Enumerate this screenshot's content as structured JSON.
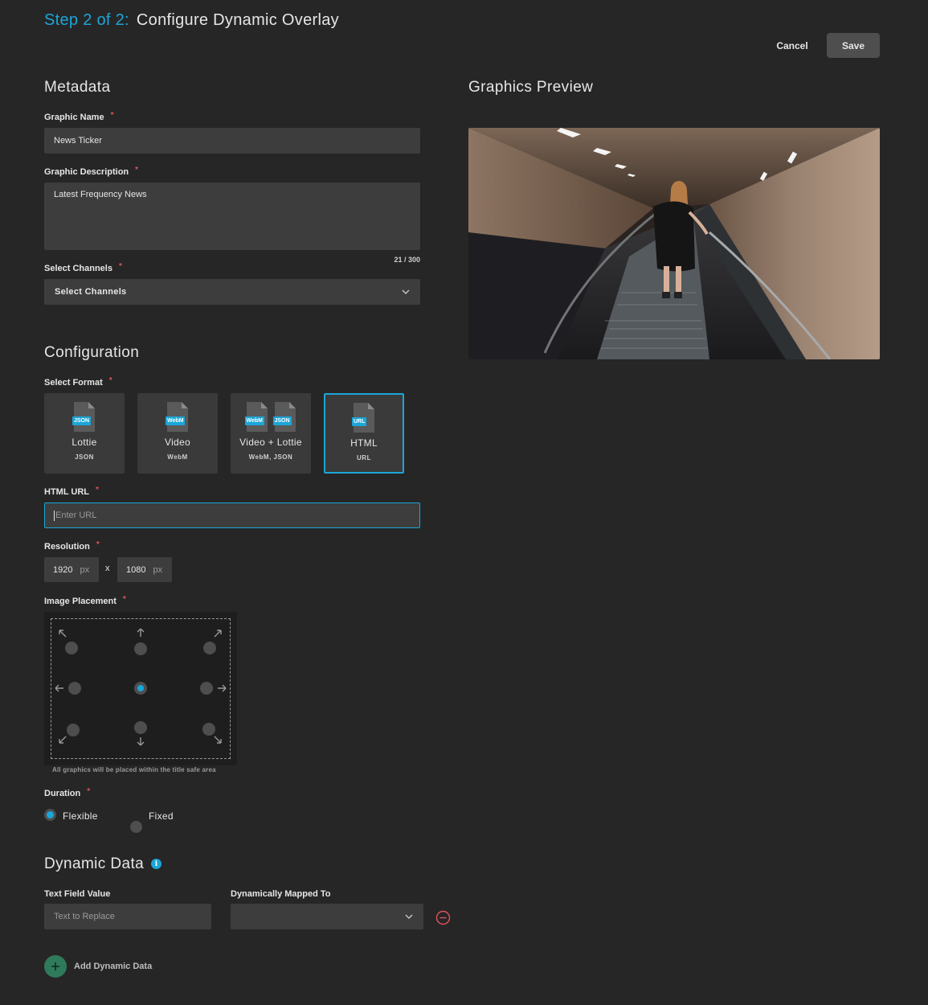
{
  "header": {
    "step": "Step 2 of 2:",
    "title": "Configure Dynamic Overlay",
    "cancel_label": "Cancel",
    "save_label": "Save"
  },
  "metadata": {
    "heading": "Metadata",
    "name_label": "Graphic Name",
    "name_value": "News Ticker",
    "description_label": "Graphic Description",
    "description_value": "Latest Frequency News",
    "char_counter": "21 / 300",
    "channels_label": "Select Channels",
    "channels_value": "Select Channels"
  },
  "preview": {
    "heading": "Graphics Preview"
  },
  "configuration": {
    "heading": "Configuration",
    "format_label": "Select Format",
    "formats": [
      {
        "name": "Lottie",
        "sub": "JSON",
        "tags": [
          "JSON"
        ]
      },
      {
        "name": "Video",
        "sub": "WebM",
        "tags": [
          "WebM"
        ]
      },
      {
        "name": "Video + Lottie",
        "sub": "WebM, JSON",
        "tags": [
          "WebM",
          "JSON"
        ]
      },
      {
        "name": "HTML",
        "sub": "URL",
        "tags": [
          "URL"
        ]
      }
    ],
    "selected_format": "HTML",
    "url_label": "HTML URL",
    "url_placeholder": "Enter URL",
    "resolution_label": "Resolution",
    "resolution_width": "1920",
    "resolution_height": "1080",
    "resolution_unit": "px",
    "resolution_separator": "x",
    "placement_label": "Image Placement",
    "placement_selected": "center",
    "placement_caption": "All graphics will be placed within the title safe area",
    "duration_label": "Duration",
    "duration_options": [
      "Flexible",
      "Fixed"
    ],
    "duration_selected": "Flexible"
  },
  "dynamic_data": {
    "heading": "Dynamic Data",
    "info_icon": "i",
    "text_field_label": "Text Field Value",
    "text_field_placeholder": "Text to Replace",
    "mapped_label": "Dynamically Mapped To",
    "mapped_value": "",
    "add_label": "Add Dynamic Data"
  },
  "colors": {
    "accent": "#1ba6d8",
    "background": "#262626",
    "required": "#e0525a",
    "add": "#2f7a5a",
    "remove": "#e0525a"
  }
}
